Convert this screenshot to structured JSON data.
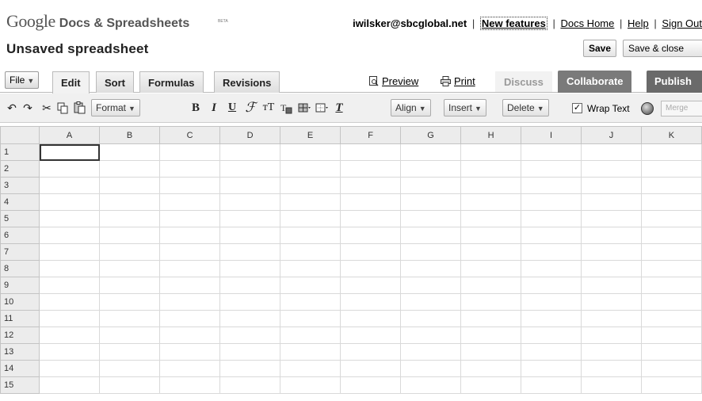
{
  "header": {
    "logo_google": "Google",
    "logo_product": "Docs & Spreadsheets",
    "logo_beta": "BETA",
    "user_email": "iwilsker@sbcglobal.net",
    "links": [
      "New features",
      "Docs Home",
      "Help",
      "Sign Out"
    ],
    "separator": "|"
  },
  "document": {
    "title": "Unsaved spreadsheet",
    "save_label": "Save",
    "save_close_label": "Save & close"
  },
  "tabs": {
    "file_label": "File",
    "edit_label": "Edit",
    "sort_label": "Sort",
    "formulas_label": "Formulas",
    "revisions_label": "Revisions",
    "preview_label": "Preview",
    "print_label": "Print",
    "discuss_label": "Discuss",
    "collaborate_label": "Collaborate",
    "publish_label": "Publish"
  },
  "toolbar": {
    "format_label": "Format",
    "bold_glyph": "B",
    "italic_glyph": "I",
    "underline_glyph": "U",
    "align_label": "Align",
    "insert_label": "Insert",
    "delete_label": "Delete",
    "wrap_text_label": "Wrap Text",
    "wrap_text_checked": true,
    "merge_label": "Merge"
  },
  "sheet": {
    "columns": [
      "A",
      "B",
      "C",
      "D",
      "E",
      "F",
      "G",
      "H",
      "I",
      "J",
      "K"
    ],
    "rows": [
      "1",
      "2",
      "3",
      "4",
      "5",
      "6",
      "7",
      "8",
      "9",
      "10",
      "11",
      "12",
      "13",
      "14",
      "15"
    ],
    "selected_cell": "A1"
  },
  "colors": {
    "collaborate_bg": "#7a7a7a",
    "publish_bg": "#6a6a6a",
    "toolbar_bg": "#f0f0f0",
    "header_cell_bg": "#ececec"
  }
}
